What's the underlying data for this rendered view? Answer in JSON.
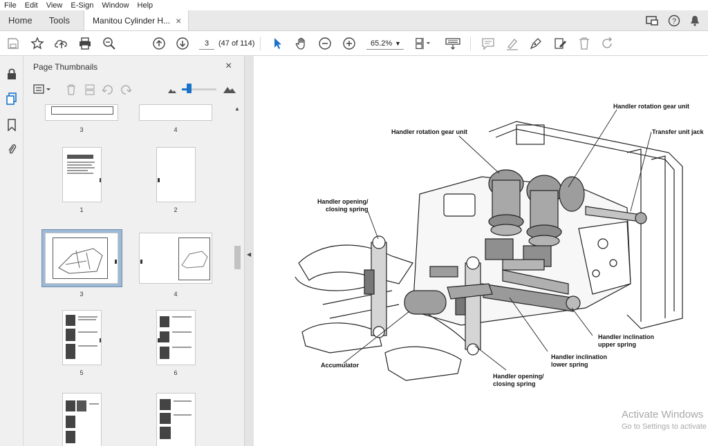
{
  "menu": [
    "File",
    "Edit",
    "View",
    "E-Sign",
    "Window",
    "Help"
  ],
  "tabs": {
    "home": "Home",
    "tools": "Tools",
    "document": "Manitou Cylinder H...",
    "close": "×"
  },
  "toolbar": {
    "page_current": "3",
    "page_count": "(47 of 114)",
    "zoom": "65.2%"
  },
  "panel": {
    "title": "Page Thumbnails",
    "close": "×"
  },
  "thumbnails": [
    {
      "label": "3"
    },
    {
      "label": "4"
    },
    {
      "label": "1"
    },
    {
      "label": "2"
    },
    {
      "label": "3"
    },
    {
      "label": "4"
    },
    {
      "label": "5"
    },
    {
      "label": "6"
    }
  ],
  "callouts": {
    "rot_gear_left": "Handler rotation gear unit",
    "rot_gear_right": "Handler rotation gear unit",
    "transfer_jack": "Transfer unit jack",
    "opening_spring_top": "Handler opening/\nclosing spring",
    "accumulator": "Accumulator",
    "incl_upper": "Handler inclination\nupper spring",
    "incl_lower": "Handler inclination\nlower spring",
    "opening_spring_bottom": "Handler opening/\nclosing spring"
  },
  "watermark": {
    "line1": "Activate Windows",
    "line2": "Go to Settings to activate"
  },
  "colors": {
    "accent": "#1a73c9",
    "selected": "#9eb9d4"
  }
}
